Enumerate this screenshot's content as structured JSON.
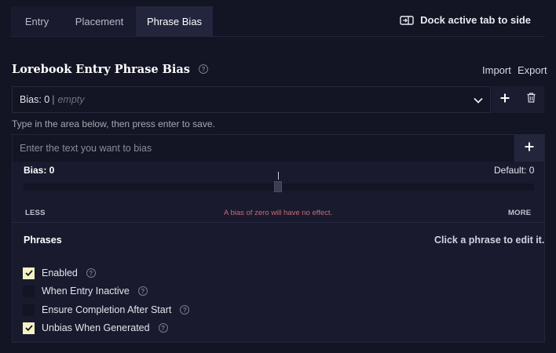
{
  "tabs": [
    {
      "label": "Entry"
    },
    {
      "label": "Placement"
    },
    {
      "label": "Phrase Bias",
      "active": true
    }
  ],
  "dock_label": "Dock active tab to side",
  "section": {
    "title": "Lorebook Entry Phrase Bias",
    "import_label": "Import",
    "export_label": "Export"
  },
  "bias_group": {
    "prefix": "Bias: 0",
    "separator": "|",
    "name_placeholder": "empty"
  },
  "hint": "Type in the area below, then press enter to save.",
  "phrase_input": {
    "placeholder": "Enter the text you want to bias",
    "value": ""
  },
  "slider": {
    "bias_label": "Bias: 0",
    "default_label": "Default: 0",
    "value": 0,
    "min_label": "LESS",
    "max_label": "MORE",
    "warning": "A bias of zero will have no effect."
  },
  "phrases": {
    "heading": "Phrases",
    "hint": "Click a phrase to edit it."
  },
  "options": [
    {
      "label": "Enabled",
      "checked": true
    },
    {
      "label": "When Entry Inactive",
      "checked": false
    },
    {
      "label": "Ensure Completion After Start",
      "checked": false
    },
    {
      "label": "Unbias When Generated",
      "checked": true
    }
  ],
  "help_glyph": "?",
  "icons": {
    "dock": "dock-side-icon",
    "add": "plus-icon",
    "delete": "trash-icon",
    "dropdown": "chevron-down-icon",
    "help": "help-circle-icon",
    "check": "checkmark-icon"
  },
  "colors": {
    "background": "#131424",
    "panel": "#191a2e",
    "active_tab": "#23253d",
    "checkbox_on": "#f5f3c2",
    "warning_text": "#c86a79"
  }
}
